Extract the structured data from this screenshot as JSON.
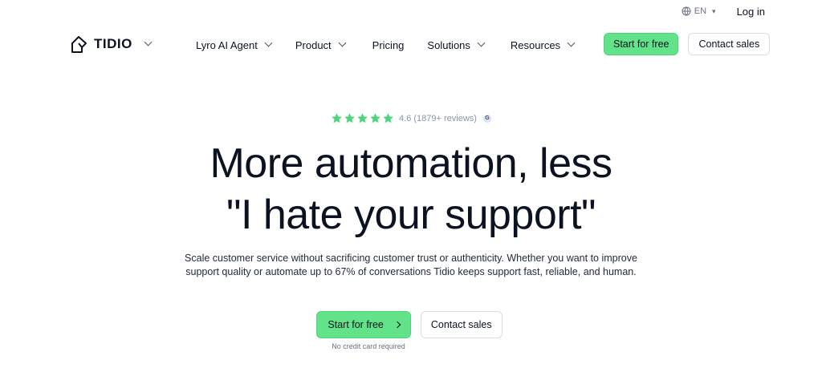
{
  "topbar": {
    "language": "EN",
    "login": "Log in"
  },
  "nav": {
    "brand": "TIDIO",
    "items": [
      {
        "label": "Lyro AI Agent",
        "dropdown": true
      },
      {
        "label": "Product",
        "dropdown": true
      },
      {
        "label": "Pricing",
        "dropdown": false
      },
      {
        "label": "Solutions",
        "dropdown": true
      },
      {
        "label": "Resources",
        "dropdown": true
      }
    ],
    "cta_primary": "Start for free",
    "cta_secondary": "Contact sales"
  },
  "hero": {
    "rating": {
      "stars": 5,
      "text": "4.6 (1879+ reviews)"
    },
    "headline_line1": "More automation, less",
    "headline_line2": "\"I hate your support\"",
    "subcopy_line1": "Scale customer service without sacrificing customer trust or authenticity. Whether you want to improve",
    "subcopy_line2": "support quality or automate up to 67% of conversations Tidio keeps support fast, reliable, and human.",
    "cta_primary": "Start for free",
    "cta_secondary": "Contact sales",
    "note": "No credit card required"
  },
  "colors": {
    "accent": "#62e38a",
    "text": "#0b1220",
    "muted": "#8a94a6"
  }
}
